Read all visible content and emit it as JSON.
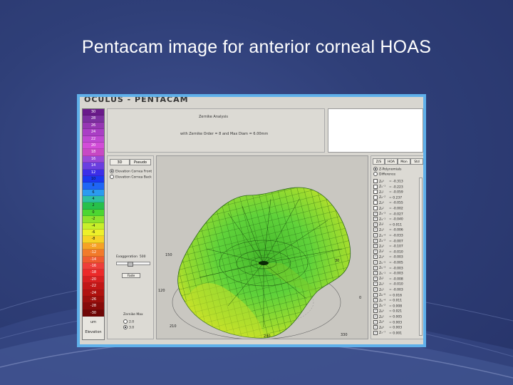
{
  "slide": {
    "title": "Pentacam image for anterior corneal HOAS"
  },
  "app": {
    "title": "OCULUS - PENTACAM"
  },
  "scale": {
    "values": [
      "30",
      "28",
      "26",
      "24",
      "22",
      "20",
      "18",
      "16",
      "14",
      "12",
      "10",
      "8",
      "6",
      "4",
      "2",
      "0",
      "-2",
      "-4",
      "-6",
      "-8",
      "-10",
      "-12",
      "-14",
      "-16",
      "-18",
      "-20",
      "-22",
      "-24",
      "-26",
      "-28",
      "-30"
    ],
    "colors": [
      "#6a1a8a",
      "#7d2fa0",
      "#9636b3",
      "#aa3ec5",
      "#bf48d2",
      "#d24cd8",
      "#c848c4",
      "#9848d8",
      "#6a3ee0",
      "#3c2ee8",
      "#1b38f0",
      "#1f66f5",
      "#2b9bf0",
      "#2dc0a0",
      "#27c04a",
      "#4cd632",
      "#8fe22c",
      "#c8ee2a",
      "#eef02a",
      "#f6d326",
      "#f6a226",
      "#f27a2a",
      "#ef5a30",
      "#ee3e3a",
      "#ec2a2a",
      "#d61f20",
      "#c21616",
      "#b0120f",
      "#9c0f0c",
      "#870a09",
      "#6f0706"
    ],
    "unit_label": "um",
    "mode_label": "Elevation"
  },
  "header": {
    "line1": "Zernike Analysis",
    "line2": "with Zernike Order = 8 and Max Diam = 6.00mm"
  },
  "controls": {
    "tab_left": "3D",
    "tab_right": "Pseudo",
    "radio_front": "Elevation Cornea Front",
    "radio_back": "Elevation Cornea Back",
    "exaggeration_label": "Exaggeration",
    "exaggeration_value": "500",
    "exaggeration_level": 0.35,
    "button_label": "Fade",
    "zernike_max_label": "Zernike Max",
    "option_a": "2.0",
    "option_b": "3.0"
  },
  "plot": {
    "axis_labels": {
      "top_right": "30",
      "top_left": "150",
      "left": "120",
      "bottom_left": "210",
      "bottom_right": "330",
      "right": "0",
      "bottom_mid": "240"
    }
  },
  "coefficients": {
    "tabs": [
      "Z/S",
      "HOA",
      "Mon",
      "Std"
    ],
    "radio_1": "Z-Polynomials",
    "radio_2": "Difference",
    "rows": [
      {
        "name": "Z₀⁰",
        "value": "-0.313",
        "checked": false
      },
      {
        "name": "Z₁⁻¹",
        "value": "-0.223",
        "checked": false
      },
      {
        "name": "Z₁¹",
        "value": "-0.059",
        "checked": false
      },
      {
        "name": "Z₂⁻²",
        "value": "0.237",
        "checked": false
      },
      {
        "name": "Z₂⁰",
        "value": "-0.055",
        "checked": false
      },
      {
        "name": "Z₂²",
        "value": "-0.002",
        "checked": false
      },
      {
        "name": "Z₃⁻³",
        "value": "-0.027",
        "checked": true
      },
      {
        "name": "Z₃⁻¹",
        "value": "-0.040",
        "checked": true
      },
      {
        "name": "Z₃¹",
        "value": "0.011",
        "checked": true
      },
      {
        "name": "Z₃³",
        "value": "-0.006",
        "checked": true
      },
      {
        "name": "Z₄⁻⁴",
        "value": "-0.033",
        "checked": true
      },
      {
        "name": "Z₄⁻²",
        "value": "-0.007",
        "checked": true
      },
      {
        "name": "Z₄⁰",
        "value": "-0.107",
        "checked": true
      },
      {
        "name": "Z₄²",
        "value": "-0.010",
        "checked": true
      },
      {
        "name": "Z₄⁴",
        "value": "-0.003",
        "checked": true
      },
      {
        "name": "Z₅⁻⁵",
        "value": "-0.005",
        "checked": true
      },
      {
        "name": "Z₅⁻³",
        "value": "-0.003",
        "checked": true
      },
      {
        "name": "Z₅⁻¹",
        "value": "-0.003",
        "checked": true
      },
      {
        "name": "Z₅¹",
        "value": "-0.008",
        "checked": true
      },
      {
        "name": "Z₅³",
        "value": "-0.010",
        "checked": true
      },
      {
        "name": "Z₅⁵",
        "value": "-0.003",
        "checked": true
      },
      {
        "name": "Z₆⁻⁶",
        "value": "0.016",
        "checked": true
      },
      {
        "name": "Z₆⁻⁴",
        "value": "0.011",
        "checked": true
      },
      {
        "name": "Z₆⁻²",
        "value": "0.008",
        "checked": true
      },
      {
        "name": "Z₆⁰",
        "value": "0.021",
        "checked": true
      },
      {
        "name": "Z₆²",
        "value": "0.005",
        "checked": true
      },
      {
        "name": "Z₆⁴",
        "value": "0.003",
        "checked": true
      },
      {
        "name": "Z₆⁶",
        "value": "0.003",
        "checked": true
      },
      {
        "name": "Z₇⁻⁷",
        "value": "0.001",
        "checked": true
      }
    ]
  }
}
